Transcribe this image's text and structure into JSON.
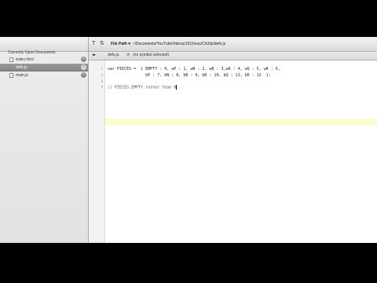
{
  "sidebar": {
    "title": "Currently Open Documents",
    "files": [
      {
        "name": "index.html",
        "active": false
      },
      {
        "name": "defs.js",
        "active": true
      },
      {
        "name": "main.js",
        "active": false
      }
    ],
    "close_glyph": "×"
  },
  "toolbar": {
    "icon_a": "T",
    "icon_b": "⇅",
    "path_label": "File Path ▾",
    "path_value": ": ~/Documents/YouTubeVideos/JSChess/Ch3/js/defs.js"
  },
  "tabbar": {
    "doc_name": "defs.js",
    "symbol": "(no symbol selected)"
  },
  "editor": {
    "lines": [
      {
        "num": "1",
        "text": "var PIECES =  { EMPTY : 0, wP : 1, wN : 2, wB : 3,wR : 4, wQ : 5, wK : 6,"
      },
      {
        "num": "2",
        "text": "                bP : 7, bN : 8, bB : 9, bR : 10, bQ : 11, bK : 12  };"
      },
      {
        "num": "3",
        "text": ""
      },
      {
        "num": "4",
        "text": "// PIECES.EMPTY rather than 0"
      }
    ]
  },
  "colors": {
    "background": "#000000",
    "current_line": "#fdfbd0",
    "active_file": "#8a8a8a"
  }
}
